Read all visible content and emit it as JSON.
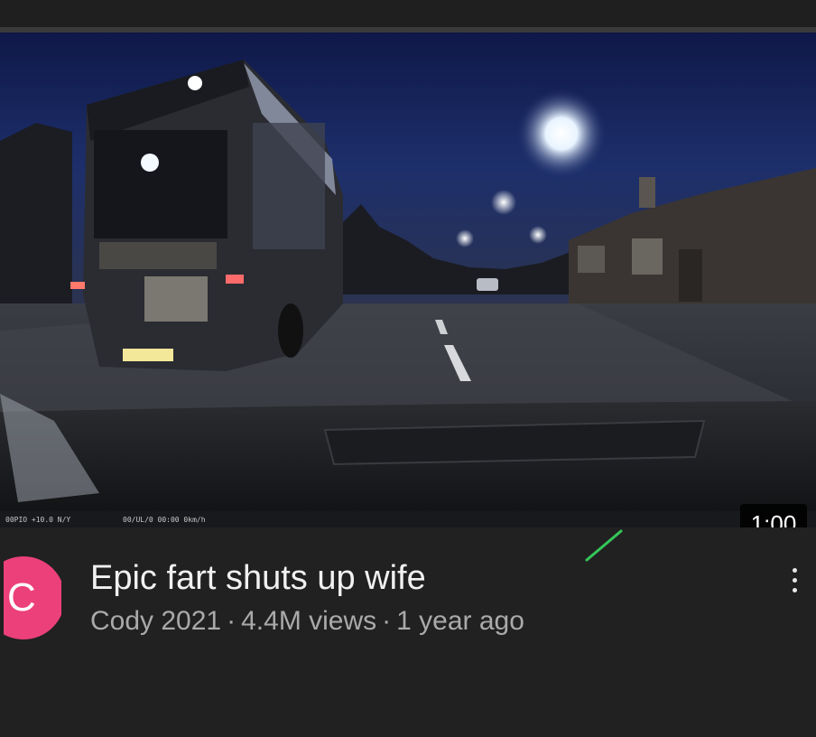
{
  "video": {
    "duration": "1:00",
    "title": "Epic fart shuts up wife",
    "channel": "Cody 2021",
    "views": "4.4M views",
    "age": "1 year ago",
    "separator": "·"
  },
  "channel_avatar": {
    "letter": "C",
    "color": "#ec407a"
  },
  "icons": {
    "menu": "kebab-menu-icon"
  },
  "colors": {
    "background": "#212121",
    "title_text": "#f1f1f1",
    "meta_text": "#aaaaaa"
  }
}
